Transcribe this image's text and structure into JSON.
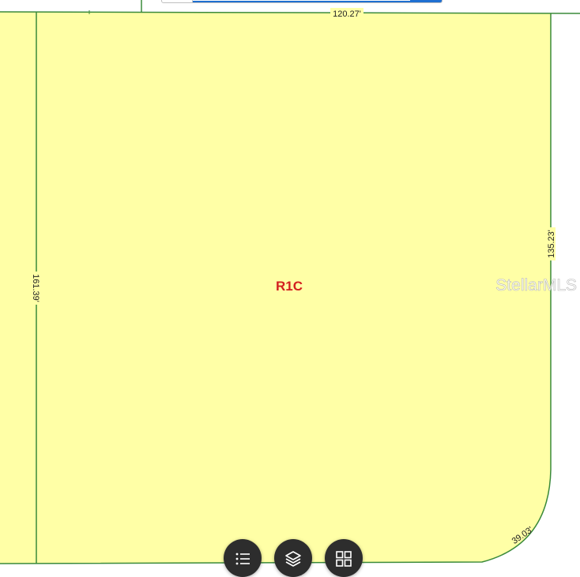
{
  "map": {
    "zone_label": "R1C",
    "dimension_top": "120.27'",
    "dimension_left": "161.39'",
    "dimension_right": "135.23'",
    "dimension_corner": "39.03'",
    "watermark": "StellarMLS"
  },
  "colors": {
    "parcel_fill": "#ffffa6",
    "parcel_line": "#3a8a3a",
    "zone_label": "#d32020",
    "fab": "#2d2d2d",
    "accent": "#1f6fd1"
  },
  "toolbar": [
    {
      "name": "legend",
      "icon": "list-icon"
    },
    {
      "name": "layers",
      "icon": "layers-icon"
    },
    {
      "name": "basemap",
      "icon": "grid-icon"
    }
  ]
}
